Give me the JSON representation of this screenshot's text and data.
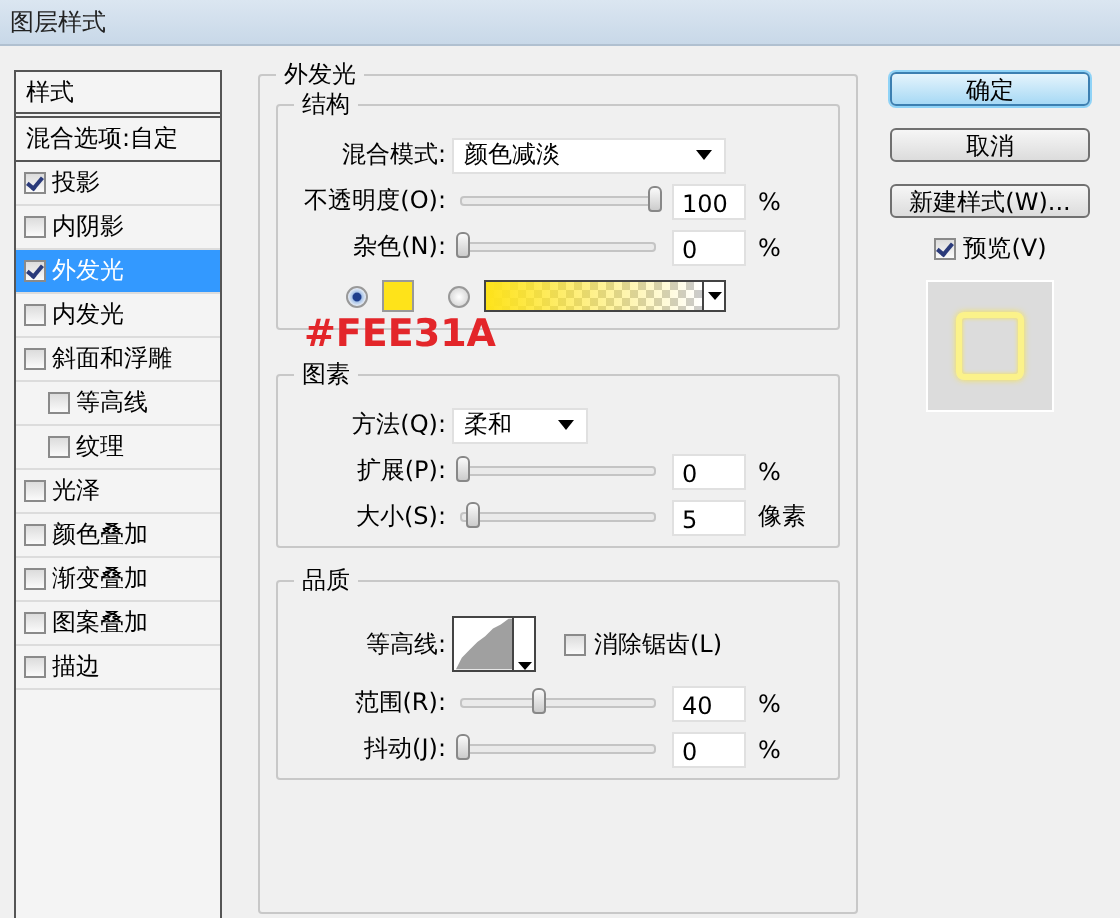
{
  "window": {
    "title": "图层样式"
  },
  "styles_list": {
    "header": "样式",
    "blend_item": "混合选项:自定",
    "items": [
      {
        "label": "投影",
        "checked": true,
        "selected": false
      },
      {
        "label": "内阴影",
        "checked": false,
        "selected": false
      },
      {
        "label": "外发光",
        "checked": true,
        "selected": true
      },
      {
        "label": "内发光",
        "checked": false,
        "selected": false
      },
      {
        "label": "斜面和浮雕",
        "checked": false,
        "selected": false,
        "children": [
          {
            "label": "等高线",
            "checked": false,
            "selected": false
          },
          {
            "label": "纹理",
            "checked": false,
            "selected": false
          }
        ]
      },
      {
        "label": "光泽",
        "checked": false,
        "selected": false
      },
      {
        "label": "颜色叠加",
        "checked": false,
        "selected": false
      },
      {
        "label": "渐变叠加",
        "checked": false,
        "selected": false
      },
      {
        "label": "图案叠加",
        "checked": false,
        "selected": false
      },
      {
        "label": "描边",
        "checked": false,
        "selected": false
      }
    ]
  },
  "outer_glow": {
    "title": "外发光",
    "structure": {
      "title": "结构",
      "blend_mode": {
        "label": "混合模式:",
        "value": "颜色减淡"
      },
      "opacity": {
        "label": "不透明度(O):",
        "level": 1,
        "value": "100",
        "unit": "%"
      },
      "noise": {
        "label": "杂色(N):",
        "level": 0,
        "value": "0",
        "unit": "%"
      },
      "color_source": [
        {
          "kind": "solid",
          "selected": true,
          "color": "#fee31a"
        },
        {
          "kind": "gradient",
          "selected": false,
          "color": "#fee31a"
        }
      ]
    },
    "annotation": "#FEE31A",
    "elements": {
      "title": "图素",
      "technique": {
        "label": "方法(Q):",
        "value": "柔和"
      },
      "spread": {
        "label": "扩展(P):",
        "level": 0,
        "value": "0",
        "unit": "%"
      },
      "size": {
        "label": "大小(S):",
        "level": 0.05,
        "value": "5",
        "unit": "像素"
      }
    },
    "quality": {
      "title": "品质",
      "contour": {
        "label": "等高线:"
      },
      "anti_alias": {
        "label": "消除锯齿(L)",
        "checked": false
      },
      "range": {
        "label": "范围(R):",
        "level": 0.4,
        "value": "40",
        "unit": "%"
      },
      "jitter": {
        "label": "抖动(J):",
        "level": 0,
        "value": "0",
        "unit": "%"
      }
    }
  },
  "buttons": [
    {
      "label": "确定",
      "default": true
    },
    {
      "label": "取消",
      "default": false
    },
    {
      "label": "新建样式(W)...",
      "default": false
    }
  ],
  "preview": {
    "label": "预览(V)",
    "checked": true
  }
}
